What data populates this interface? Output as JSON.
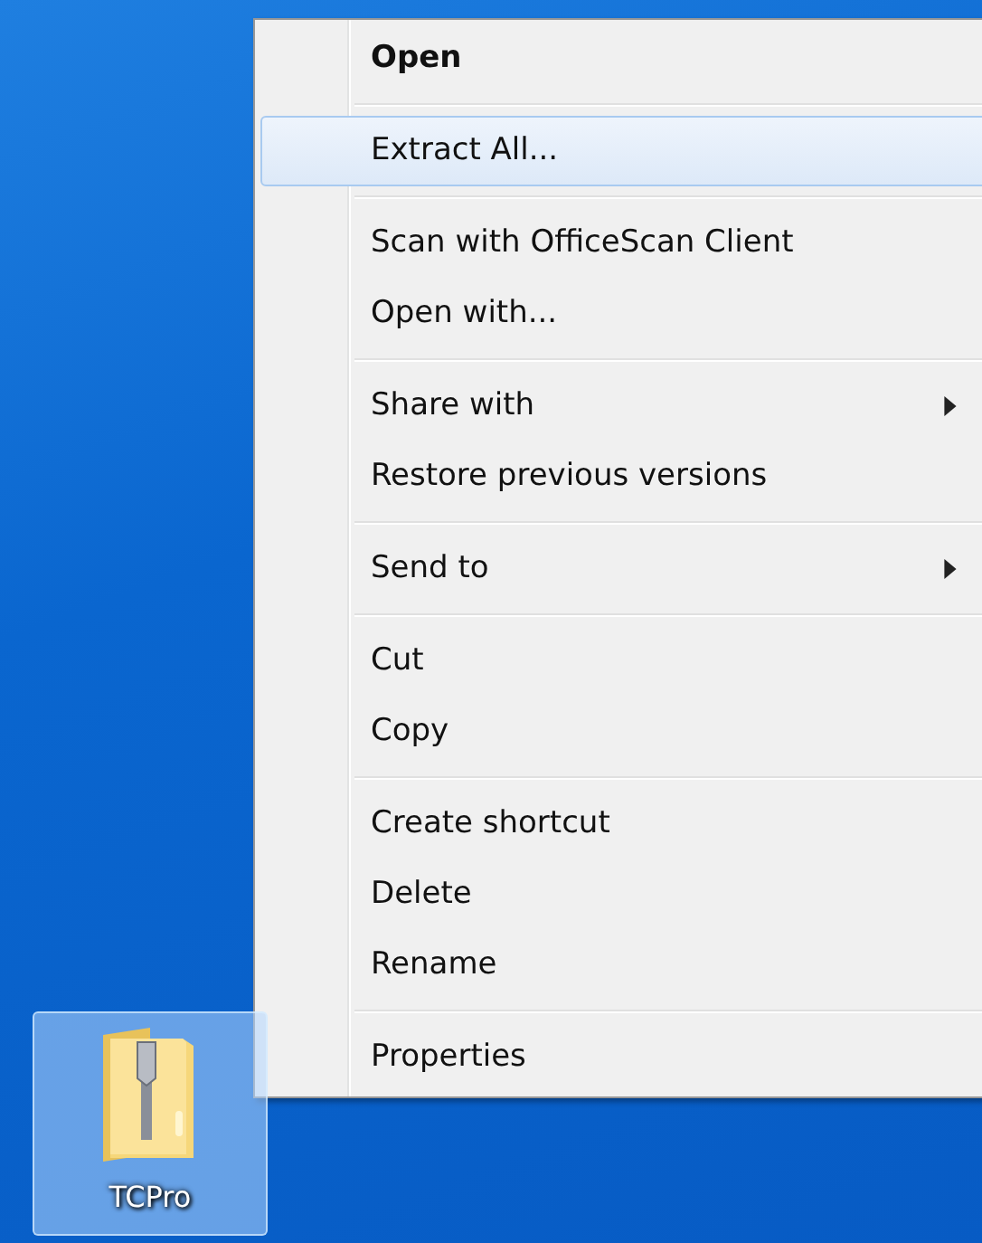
{
  "desktop_icon": {
    "label": "TCPro",
    "selected": true
  },
  "context_menu": {
    "groups": [
      {
        "items": [
          {
            "label": "Open",
            "default": true,
            "selected": false,
            "submenu": false
          }
        ]
      },
      {
        "items": [
          {
            "label": "Extract All...",
            "default": false,
            "selected": true,
            "submenu": false
          }
        ]
      },
      {
        "items": [
          {
            "label": "Scan with OfficeScan Client",
            "default": false,
            "selected": false,
            "submenu": false
          },
          {
            "label": "Open with...",
            "default": false,
            "selected": false,
            "submenu": false
          }
        ]
      },
      {
        "items": [
          {
            "label": "Share with",
            "default": false,
            "selected": false,
            "submenu": true
          },
          {
            "label": "Restore previous versions",
            "default": false,
            "selected": false,
            "submenu": false
          }
        ]
      },
      {
        "items": [
          {
            "label": "Send to",
            "default": false,
            "selected": false,
            "submenu": true
          }
        ]
      },
      {
        "items": [
          {
            "label": "Cut",
            "default": false,
            "selected": false,
            "submenu": false
          },
          {
            "label": "Copy",
            "default": false,
            "selected": false,
            "submenu": false
          }
        ]
      },
      {
        "items": [
          {
            "label": "Create shortcut",
            "default": false,
            "selected": false,
            "submenu": false
          },
          {
            "label": "Delete",
            "default": false,
            "selected": false,
            "submenu": false
          },
          {
            "label": "Rename",
            "default": false,
            "selected": false,
            "submenu": false
          }
        ]
      },
      {
        "items": [
          {
            "label": "Properties",
            "default": false,
            "selected": false,
            "submenu": false
          }
        ]
      }
    ]
  }
}
